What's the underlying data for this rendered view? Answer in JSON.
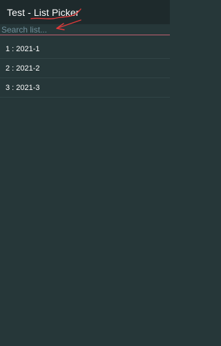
{
  "header": {
    "title": "Test - List Picker"
  },
  "search": {
    "placeholder": "Search list...",
    "value": ""
  },
  "list": {
    "items": [
      {
        "label": "1 : 2021-1"
      },
      {
        "label": "2 : 2021-2"
      },
      {
        "label": "3 : 2021-3"
      }
    ]
  },
  "colors": {
    "background": "#263739",
    "titlebar": "#1e2a2c",
    "annotation": "#e03a3a",
    "search_underline": "#c06070"
  },
  "annotations": {
    "title_underline": "red-scribble-underline",
    "search_arrow": "red-arrow-pointing-to-search"
  }
}
